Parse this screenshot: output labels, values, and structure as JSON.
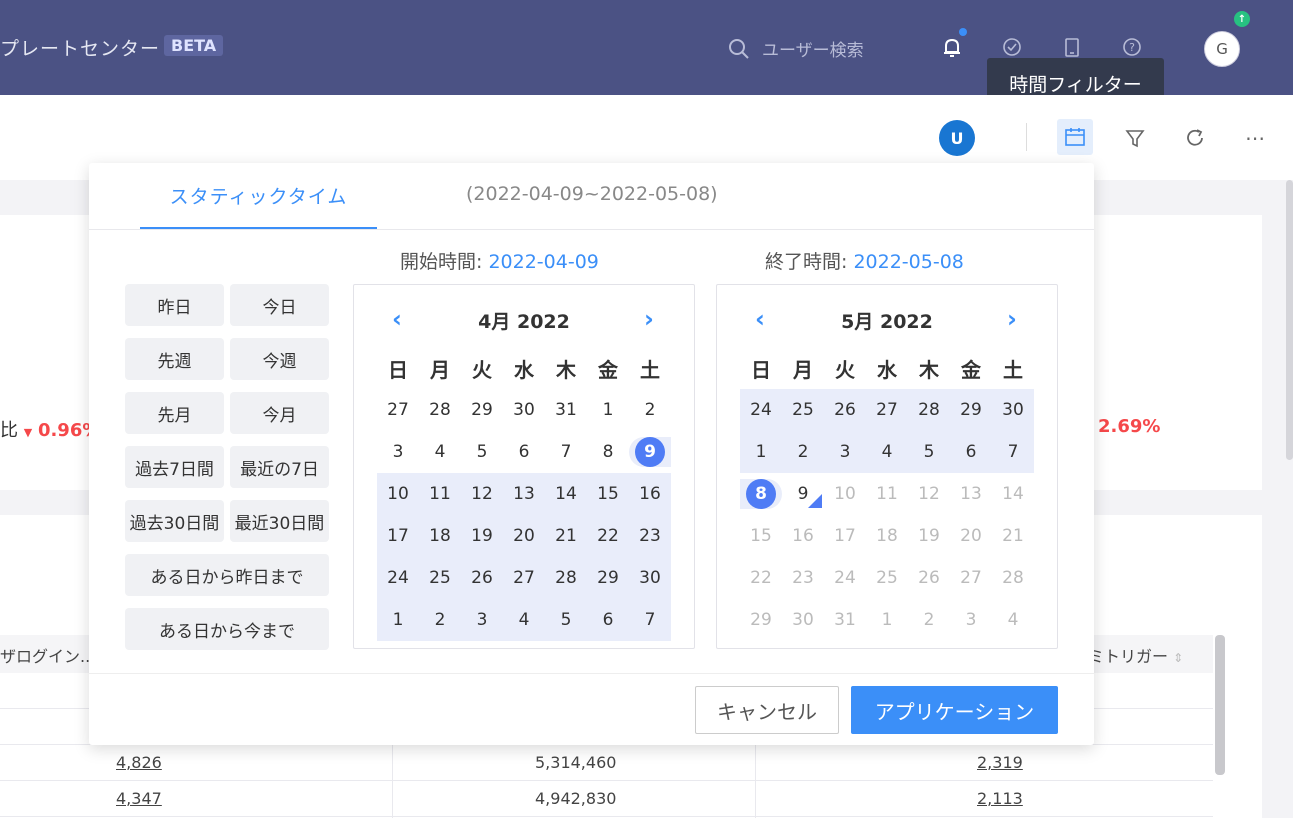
{
  "header": {
    "title": "プレートセンター",
    "beta": "BETA",
    "search_placeholder": "ユーザー検索",
    "avatar": "G"
  },
  "toolbar": {
    "avatar": "U",
    "tooltip": "時間フィルター"
  },
  "background": {
    "left_label": "比",
    "left_pct": "0.96%",
    "right_pct": "2.69%",
    "col_left": "ザログイン...",
    "col_right": "ミトリガー",
    "rows": [
      {
        "a": "4,826",
        "b": "5,314,460",
        "c": "2,319"
      },
      {
        "a": "4,347",
        "b": "4,942,830",
        "c": "2,113"
      }
    ]
  },
  "panel": {
    "tab_static": "スタティックタイム",
    "tab_range": "(2022-04-09~2022-05-08)",
    "start_label": "開始時間:",
    "start_value": "2022-04-09",
    "end_label": "終了時間:",
    "end_value": "2022-05-08",
    "quick": [
      "昨日",
      "今日",
      "先週",
      "今週",
      "先月",
      "今月",
      "過去7日間",
      "最近の7日",
      "過去30日間",
      "最近30日間",
      "ある日から昨日まで",
      "ある日から今まで"
    ],
    "weekdays": [
      "日",
      "月",
      "火",
      "水",
      "木",
      "金",
      "土"
    ],
    "left_month": "4月 2022",
    "right_month": "5月 2022",
    "left_days": [
      [
        "27",
        "28",
        "29",
        "30",
        "31",
        "1",
        "2"
      ],
      [
        "3",
        "4",
        "5",
        "6",
        "7",
        "8",
        "9"
      ],
      [
        "10",
        "11",
        "12",
        "13",
        "14",
        "15",
        "16"
      ],
      [
        "17",
        "18",
        "19",
        "20",
        "21",
        "22",
        "23"
      ],
      [
        "24",
        "25",
        "26",
        "27",
        "28",
        "29",
        "30"
      ],
      [
        "1",
        "2",
        "3",
        "4",
        "5",
        "6",
        "7"
      ]
    ],
    "right_days": [
      [
        "24",
        "25",
        "26",
        "27",
        "28",
        "29",
        "30"
      ],
      [
        "1",
        "2",
        "3",
        "4",
        "5",
        "6",
        "7"
      ],
      [
        "8",
        "9",
        "10",
        "11",
        "12",
        "13",
        "14"
      ],
      [
        "15",
        "16",
        "17",
        "18",
        "19",
        "20",
        "21"
      ],
      [
        "22",
        "23",
        "24",
        "25",
        "26",
        "27",
        "28"
      ],
      [
        "29",
        "30",
        "31",
        "1",
        "2",
        "3",
        "4"
      ]
    ],
    "cancel": "キャンセル",
    "apply": "アプリケーション"
  }
}
